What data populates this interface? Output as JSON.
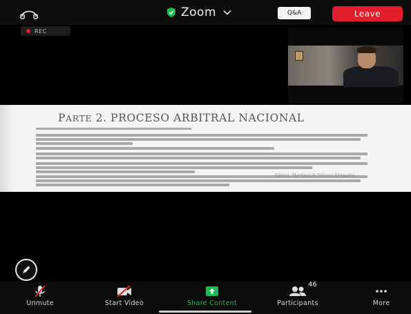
{
  "top_bar": {
    "app_title": "Zoom",
    "qa_label": "Q&A",
    "leave_label": "Leave"
  },
  "recording": {
    "label": "REC"
  },
  "slide": {
    "title_prefix_big": "P",
    "title_prefix_small": "ARTE",
    "title_rest": " 2. PROCESO ARBITRAL NACIONAL",
    "footer": "Gómez, Martínez & Velasco Abogados"
  },
  "toolbar": {
    "unmute_label": "Unmute",
    "start_video_label": "Start Video",
    "share_label": "Share Content",
    "participants_label": "Participants",
    "participants_count": "46",
    "more_label": "More"
  },
  "colors": {
    "leave": "#e01e2c",
    "share": "#1db954",
    "shield": "#1db954"
  },
  "icons": [
    "audio-icon",
    "shield-icon",
    "chevron-down-icon",
    "pen-icon",
    "muted-mic-icon",
    "video-off-icon",
    "share-up-arrow-icon",
    "participants-icon",
    "more-dots-icon"
  ]
}
